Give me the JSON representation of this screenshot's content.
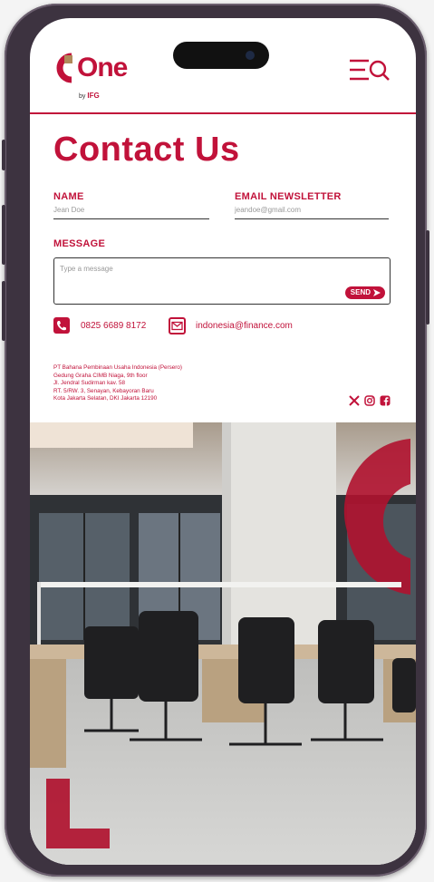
{
  "header": {
    "logo_text": "One",
    "logo_sub_by": "by",
    "logo_sub_brand": "IFG",
    "menu_icon": "menu-search-icon"
  },
  "page": {
    "title": "Contact Us"
  },
  "form": {
    "name_label": "NAME",
    "name_placeholder": "Jean Doe",
    "email_label": "EMAIL NEWSLETTER",
    "email_placeholder": "jeandoe@gmail.com",
    "message_label": "MESSAGE",
    "message_placeholder": "Type a message",
    "send_label": "SEND"
  },
  "contact": {
    "phone": "0825 6689 8172",
    "email": "indonesia@finance.com"
  },
  "address": {
    "lines": [
      "PT Bahana Pembinaan Usaha Indonesia (Persero)",
      "Gedung Graha CIMB Niaga, 9th floor",
      "Jl. Jendral Sudirman kav. 58",
      "RT. 5/RW. 3, Senayan, Kebayoran Baru",
      "Kota Jakarta Selatan, DKI Jakarta 12190"
    ]
  },
  "socials": [
    "x-icon",
    "instagram-icon",
    "facebook-icon"
  ],
  "colors": {
    "brand": "#c1123a",
    "frame": "#3d3340"
  }
}
